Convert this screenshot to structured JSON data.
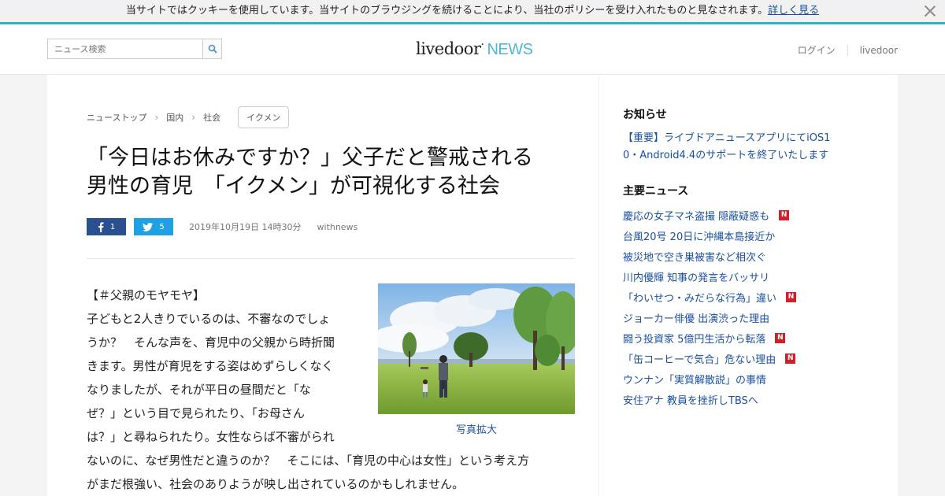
{
  "cookie": {
    "message": "当サイトではクッキーを使用しています。当サイトのブラウジングを続けることにより、当社のポリシーを受け入れたものと見なされます。",
    "link": "詳しく見る"
  },
  "header": {
    "search_placeholder": "ニュース検索",
    "logo_main": "livedoor",
    "logo_dot": "·",
    "logo_news": "NEWS",
    "login": "ログイン",
    "livedoor": "livedoor"
  },
  "breadcrumb": {
    "items": [
      "ニューストップ",
      "国内",
      "社会"
    ],
    "tag": "イクメン"
  },
  "article": {
    "title_line1": "「今日はお休みですか？」父子だと警戒される",
    "title_line2": "男性の育児　「イクメン」が可視化する社会",
    "fb_count": "1",
    "tw_count": "5",
    "date": "2019年10月19日 14時30分",
    "source": "withnews",
    "heading": "【＃父親のモヤモヤ】",
    "lines": [
      "子どもと2人きりでいるのは、不審なのでしょ",
      "うか？　そんな声を、育児中の父親から時折聞",
      "きます。男性が育児をする姿はめずらしくなく",
      "なりましたが、それが平日の昼間だと「な",
      "ぜ？」という目で見られたり、「お母さん",
      "は？」と尋ねられたり。女性ならば不審がられ"
    ],
    "wide_lines": [
      "ないのに、なぜ男性だと違うのか？　そこには、「育児の中心は女性」という考え方",
      "がまだ根強い、社会のありようが映し出されているのかもしれません。"
    ],
    "photo_caption": "写真拡大"
  },
  "sidebar": {
    "notice_title": "お知らせ",
    "notice_line1": "【重要】ライブドアニュースアプリにてiOS1",
    "notice_line2": "0・Android4.4のサポートを終了いたします",
    "news_title": "主要ニュース",
    "news": [
      {
        "text": "慶応の女子マネ盗撮 隠蔽疑惑も",
        "badge": "N"
      },
      {
        "text": "台風20号 20日に沖縄本島接近か",
        "badge": ""
      },
      {
        "text": "被災地で空き巣被害など相次ぐ",
        "badge": ""
      },
      {
        "text": "川内優輝 知事の発言をバッサリ",
        "badge": ""
      },
      {
        "text": "「わいせつ・みだらな行為」違い",
        "badge": "N"
      },
      {
        "text": "ジョーカー俳優 出演渋った理由",
        "badge": ""
      },
      {
        "text": "闘う投資家 5億円生活から転落",
        "badge": "N"
      },
      {
        "text": "「缶コーヒーで気合」危ない理由",
        "badge": "N"
      },
      {
        "text": "ウンナン「実質解散説」の事情",
        "badge": ""
      },
      {
        "text": "安住アナ 教員を挫折しTBSへ",
        "badge": ""
      }
    ]
  },
  "colors": {
    "accent": "#2eb2c9",
    "link": "#1a4fa0",
    "facebook": "#2a4f8f",
    "twitter": "#1da1e2",
    "new_badge": "#d0202c"
  }
}
